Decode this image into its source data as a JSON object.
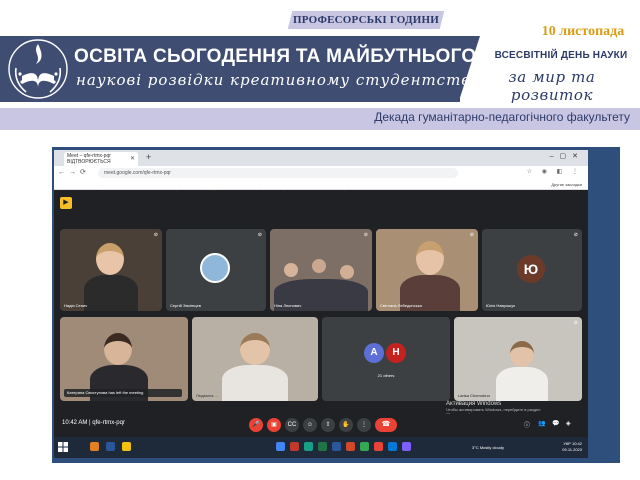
{
  "header": {
    "tag": "ПРОФЕСОРСЬКІ ГОДИНИ",
    "title_main": "ОСВІТА СЬОГОДЕННЯ ТА МАЙБУТНЬОГО:",
    "title_sub": "наукові розвідки креативному студентству",
    "date": "10 листопада",
    "world_day": "ВСЕСВІТНІЙ ДЕНЬ НАУКИ",
    "peace": "за мир та розвиток",
    "decade": "Декада гуманітарно-педагогічного факультету"
  },
  "colors": {
    "banner": "#3f4d73",
    "light_band": "#c9c6e4",
    "accent_date": "#d89c12",
    "frame": "#2e4f7c",
    "meet_bg": "#202124",
    "end_call": "#ea4335"
  },
  "browser": {
    "tab_title": "Meet – qfe-rtmx-pqr",
    "tab_subtitle": "ВІДТВОРЮЄТЬСЯ",
    "url": "meet.google.com/qfe-rtmx-pqr",
    "bookmarks": [
      "Автозаполнение",
      "Яндекс",
      "Начальная страница",
      "Google",
      "UKR.NET: Всі новини ...",
      "YouTube",
      "Gmail",
      "pdf to word",
      "SaveFrom.net Helper"
    ],
    "bookmarks_right": "Другие закладки"
  },
  "meet": {
    "participants": [
      {
        "name": "Надія Сенич"
      },
      {
        "name": "Сергій Звягінцев"
      },
      {
        "name": "Ніна Леонович"
      },
      {
        "name": "Світлана Лебединська"
      },
      {
        "name": "Юлія Наврошук",
        "initial": "Ю"
      },
      {
        "name": "Катерина Свистунова"
      },
      {
        "name": "Людмила ..."
      },
      {
        "name": "Larisa Chornobun"
      }
    ],
    "others_initials": [
      "А",
      "Н"
    ],
    "others_label": "21 others",
    "toast": "Катерина Свистунова has left the meeting",
    "time": "10:42 AM",
    "meeting_code": "qfe-rtmx-pqr",
    "activation_title": "Активация Windows",
    "activation_text_1": "Чтобы активировать Windows, перейдите в раздел",
    "activation_text_2": "\"Параметры\"."
  },
  "taskbar": {
    "weather": "3°C  Mostly cloudy",
    "lang": "УКР",
    "clock": "10:42",
    "date": "09.11.2023"
  }
}
